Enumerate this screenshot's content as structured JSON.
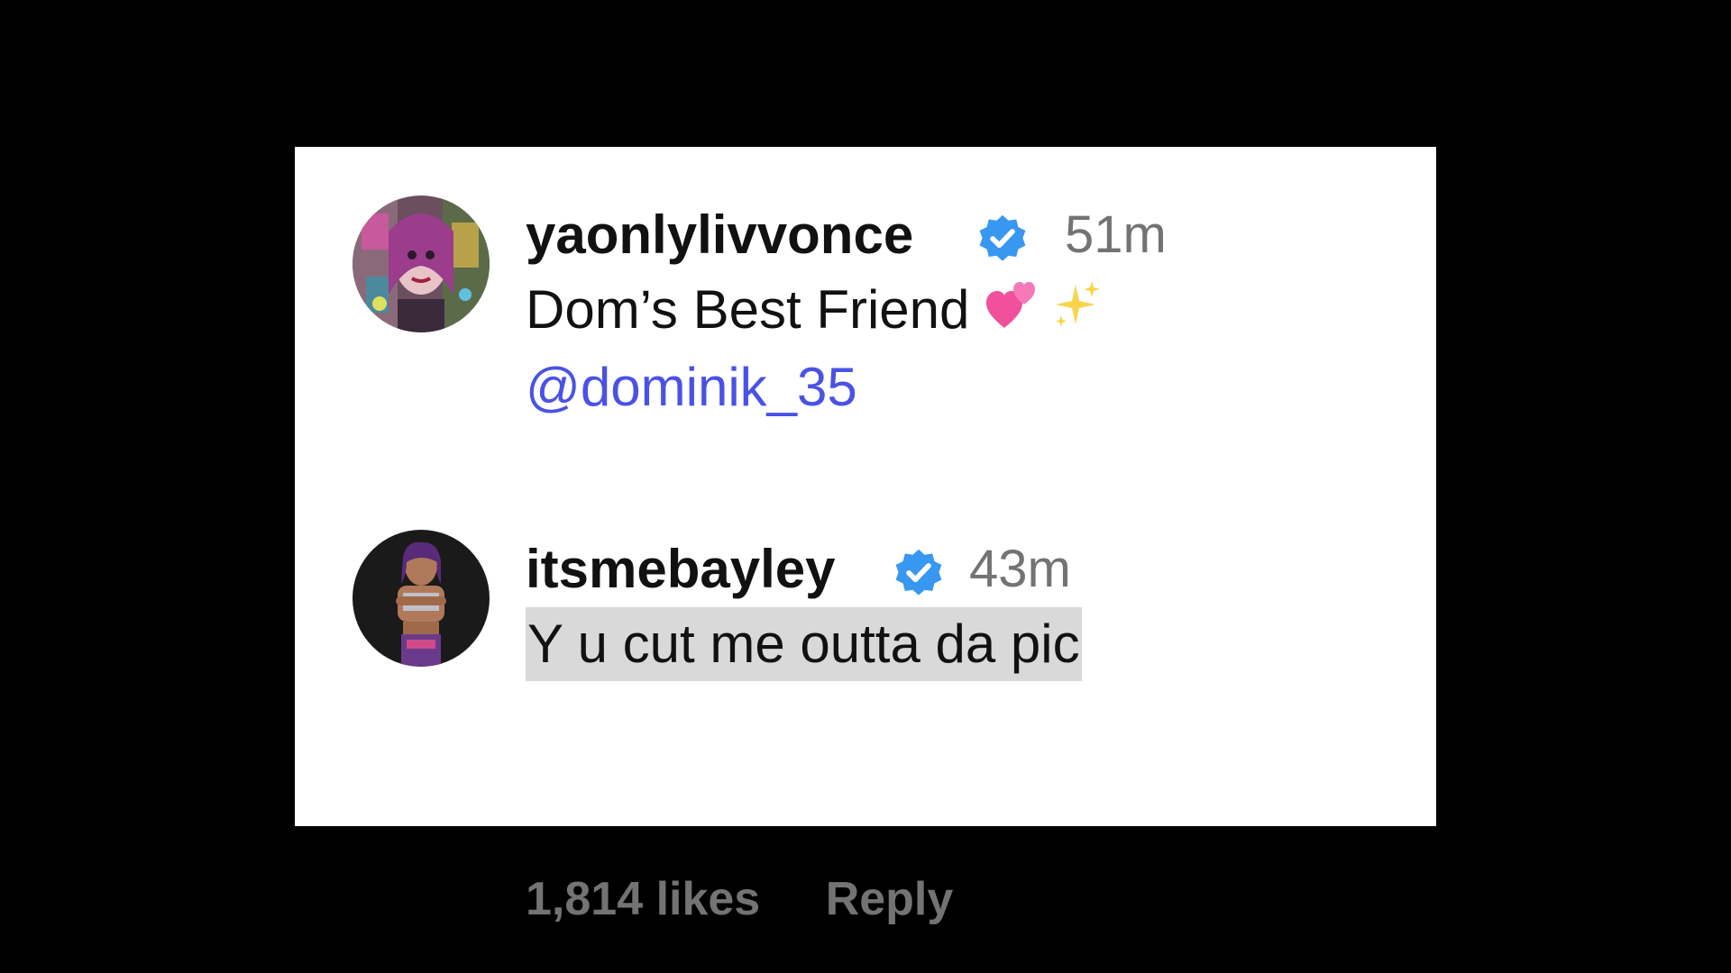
{
  "comments": [
    {
      "username": "yaonlylivvonce",
      "verified": true,
      "time": "51m",
      "text": "Dom’s Best Friend",
      "emojis": [
        "two-hearts-icon",
        "sparkles-icon"
      ],
      "mention": "@dominik_35",
      "avatar": "avatar-colorful-portrait"
    },
    {
      "username": "itsmebayley",
      "verified": true,
      "time": "43m",
      "text": "Y u cut me outta da pic",
      "avatar": "avatar-wrestler-photo",
      "likes": "1,814 likes",
      "reply_label": "Reply"
    }
  ],
  "colors": {
    "background": "#000000",
    "card": "#ffffff",
    "text": "#111111",
    "muted": "#737373",
    "mention": "#4a52e6",
    "verified": "#3897f0",
    "highlight": "#d9d9d9"
  }
}
